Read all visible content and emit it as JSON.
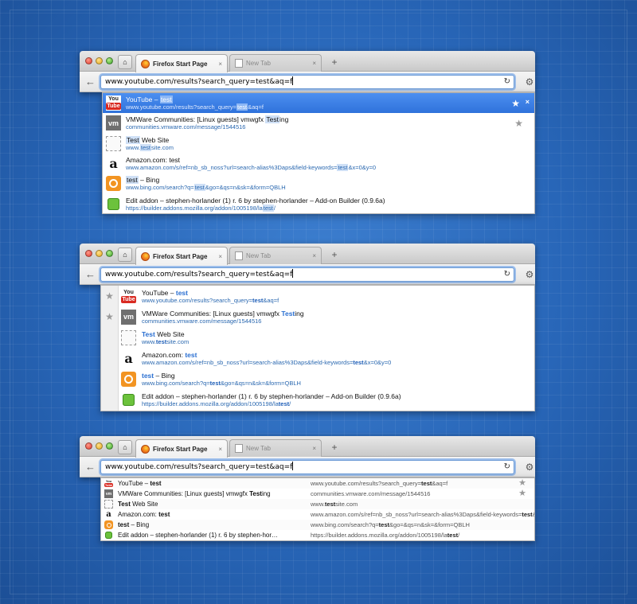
{
  "window": {
    "tab_active_label": "Firefox Start Page",
    "tab_inactive_label": "New Tab",
    "tab_close_glyph": "×",
    "new_tab_glyph": "+",
    "url": "www.youtube.com/results?search_query=test&aq=f"
  },
  "icons": {
    "back": "←",
    "reload": "↻",
    "gear": "⚙",
    "home": "⌂",
    "star": "★",
    "remove": "×"
  },
  "results": [
    {
      "icon": "youtube-icon",
      "title_pre": "YouTube – ",
      "title_hl": "test",
      "title_post": "",
      "url_pre": "www.youtube.com/results?search_query=",
      "url_hl": "test",
      "url_post": "&aq=f",
      "starred": true
    },
    {
      "icon": "vmware-icon",
      "title_pre": "VMWare Communities: [Linux guests] vmwgfx ",
      "title_hl": "Test",
      "title_post": "ing",
      "url_pre": "communities.vmware.com/message/1544516",
      "url_hl": "",
      "url_post": "",
      "starred": true
    },
    {
      "icon": "blank-page-icon",
      "title_pre": "",
      "title_hl": "Test",
      "title_post": " Web Site",
      "url_pre": "www.",
      "url_hl": "test",
      "url_post": "site.com",
      "starred": false
    },
    {
      "icon": "amazon-icon",
      "title_pre": "Amazon.com: ",
      "title_hl": "test",
      "title_post": "",
      "url_pre": "www.amazon.com/s/ref=nb_sb_noss?url=search-alias%3Daps&field-keywords=",
      "url_hl": "test",
      "url_post": "&x=0&y=0",
      "starred": false
    },
    {
      "icon": "bing-icon",
      "title_pre": "",
      "title_hl": "test",
      "title_post": " – Bing",
      "url_pre": "www.bing.com/search?q=",
      "url_hl": "test",
      "url_post": "&go=&qs=n&sk=&form=QBLH",
      "starred": false
    },
    {
      "icon": "addon-puzzle-icon",
      "title_pre": "Edit addon – stephen-horlander (1) r. 6 by stephen-horlander – Add-on Builder (0.9.6a)",
      "title_hl": "",
      "title_post": "",
      "url_pre": "https://builder.addons.mozilla.org/addon/1005198/la",
      "url_hl": "test",
      "url_post": "/",
      "starred": false
    }
  ],
  "compact_truncated_title": "Edit addon – stephen-horlander (1) r. 6 by stephen-hor…",
  "colors": {
    "selection": "#3a7fe6",
    "highlight": "#cfe0f6",
    "url_text": "#2a68b0"
  }
}
